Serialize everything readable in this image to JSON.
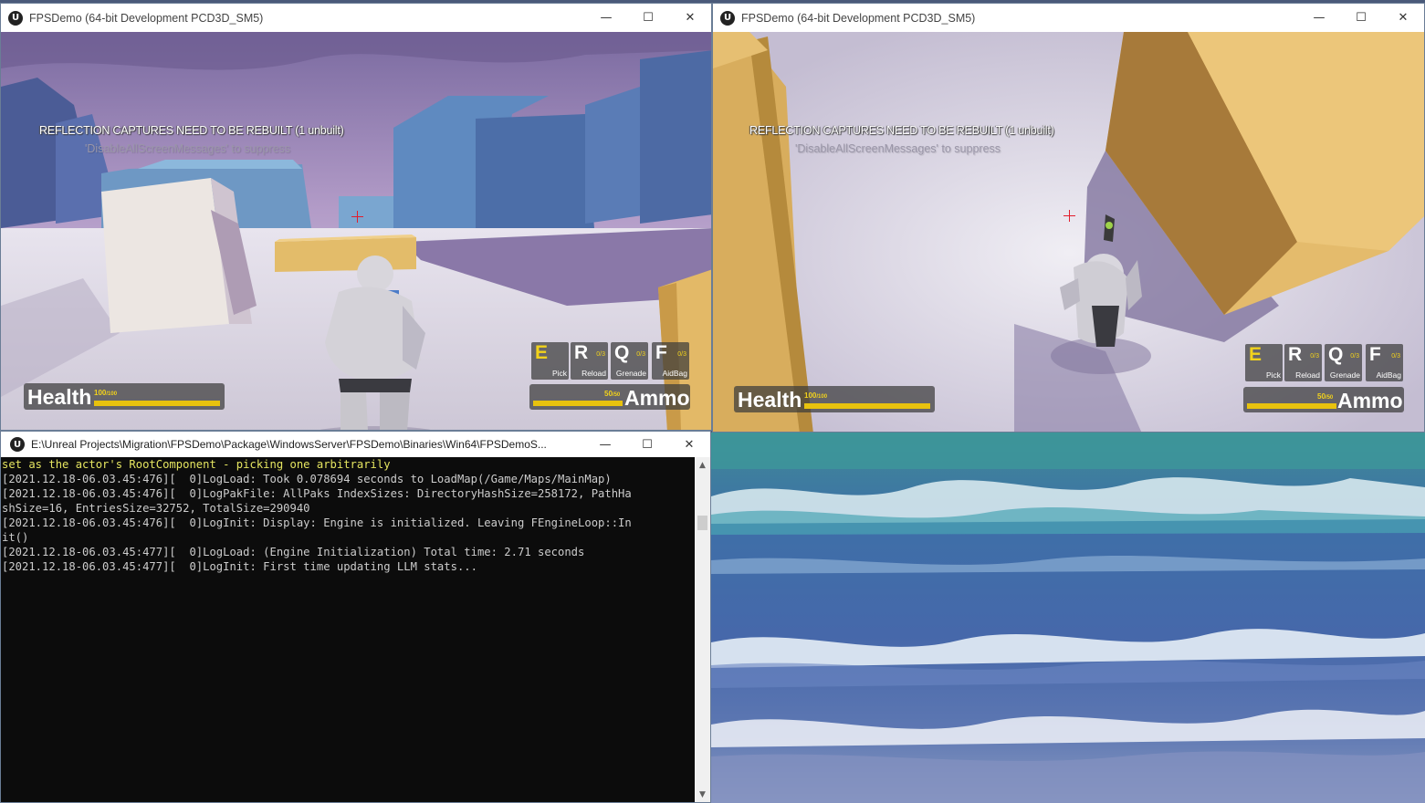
{
  "game_windows": [
    {
      "title": "FPSDemo (64-bit Development PCD3D_SM5)",
      "message_line1": "REFLECTION CAPTURES NEED TO BE REBUILT (1 unbuilt)",
      "message_line2": "'DisableAllScreenMessages' to suppress",
      "hud": {
        "health_label": "Health",
        "health_value": "100",
        "health_max": "/100",
        "health_fraction": 1.0,
        "ammo_label": "Ammo",
        "ammo_value": "50",
        "ammo_max": "/50",
        "ammo_fraction": 1.0,
        "keys": [
          {
            "key": "E",
            "count": "",
            "name": "Pick"
          },
          {
            "key": "R",
            "count": "0/3",
            "name": "Reload"
          },
          {
            "key": "Q",
            "count": "0/3",
            "name": "Grenade"
          },
          {
            "key": "F",
            "count": "0/3",
            "name": "AidBag"
          }
        ]
      }
    },
    {
      "title": "FPSDemo (64-bit Development PCD3D_SM5)",
      "message_line1": "REFLECTION CAPTURES NEED TO BE REBUILT (1 unbuilt)",
      "message_line2": "'DisableAllScreenMessages' to suppress",
      "hud": {
        "health_label": "Health",
        "health_value": "100",
        "health_max": "/100",
        "health_fraction": 1.0,
        "ammo_label": "Ammo",
        "ammo_value": "50",
        "ammo_max": "/50",
        "ammo_fraction": 1.0,
        "keys": [
          {
            "key": "E",
            "count": "",
            "name": "Pick"
          },
          {
            "key": "R",
            "count": "0/3",
            "name": "Reload"
          },
          {
            "key": "Q",
            "count": "0/3",
            "name": "Grenade"
          },
          {
            "key": "F",
            "count": "0/3",
            "name": "AidBag"
          }
        ]
      }
    }
  ],
  "window_controls": {
    "minimize": "—",
    "maximize": "☐",
    "close": "✕"
  },
  "console": {
    "title": "E:\\Unreal Projects\\Migration\\FPSDemo\\Package\\WindowsServer\\FPSDemo\\Binaries\\Win64\\FPSDemoS...",
    "lines": [
      "set as the actor's RootComponent - picking one arbitrarily",
      "[2021.12.18-06.03.45:476][  0]LogLoad: Took 0.078694 seconds to LoadMap(/Game/Maps/MainMap)",
      "[2021.12.18-06.03.45:476][  0]LogPakFile: AllPaks IndexSizes: DirectoryHashSize=258172, PathHa",
      "shSize=16, EntriesSize=32752, TotalSize=290940",
      "[2021.12.18-06.03.45:476][  0]LogInit: Display: Engine is initialized. Leaving FEngineLoop::In",
      "it()",
      "[2021.12.18-06.03.45:477][  0]LogLoad: (Engine Initialization) Total time: 2.71 seconds",
      "[2021.12.18-06.03.45:477][  0]LogInit: First time updating LLM stats..."
    ],
    "scroll_up": "▲",
    "scroll_down": "▼"
  },
  "colors": {
    "hud_accent": "#e8c20e",
    "crosshair": "#e21d2c",
    "console_bg": "#0c0c0c",
    "console_highlight": "#e5e560"
  },
  "icons": {
    "app": "unreal-engine-icon",
    "console": "unreal-engine-icon"
  }
}
